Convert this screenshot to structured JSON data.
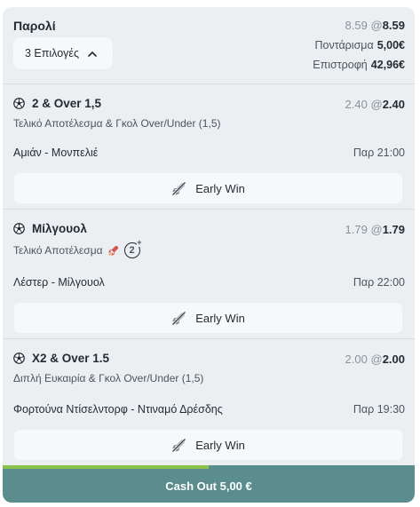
{
  "header": {
    "title": "Παρολί",
    "odds_original": "8.59",
    "odds_at": "@",
    "odds_current": "8.59",
    "selections_label": "3 Επιλογές",
    "stake_label": "Ποντάρισμα",
    "stake_value": "5,00€",
    "return_label": "Επιστροφή",
    "return_value": "42,96€"
  },
  "bets": [
    {
      "name": "2 & Over 1,5",
      "market": "Τελικό Αποτέλεσμα & Γκολ Over/Under (1,5)",
      "odds_original": "2.40",
      "odds_current": "2.40",
      "match": "Αμιάν - Μονπελιέ",
      "time": "Παρ 21:00",
      "early_win": "Early Win"
    },
    {
      "name": "Μίλγουολ",
      "market": "Τελικό Αποτέλεσμα",
      "boost_badge": "2",
      "boost_plus": "+",
      "odds_original": "1.79",
      "odds_current": "1.79",
      "match": "Λέστερ - Μίλγουολ",
      "time": "Παρ 22:00",
      "early_win": "Early Win"
    },
    {
      "name": "X2 & Over 1.5",
      "market": "Διπλή Ευκαιρία & Γκολ Over/Under (1,5)",
      "odds_original": "2.00",
      "odds_current": "2.00",
      "match": "Φορτούνα Ντίσελντορφ - Ντιναμό Δρέσδης",
      "time": "Παρ 19:30",
      "early_win": "Early Win"
    }
  ],
  "cashout": {
    "label": "Cash Out 5,00 €",
    "progress": 0.5
  },
  "icons": {
    "sport": "football-icon",
    "early_win": "rocket-slash-icon",
    "boost": "rocket-icon",
    "selections_toggle": "chevron-up-icon"
  },
  "colors": {
    "card_bg": "#eceff2",
    "button_bg": "#f7f8f9",
    "cashout_bg": "#5b8c8e",
    "progress": "#8bc34a",
    "text": "#1f2a33",
    "muted": "#8a939b"
  }
}
